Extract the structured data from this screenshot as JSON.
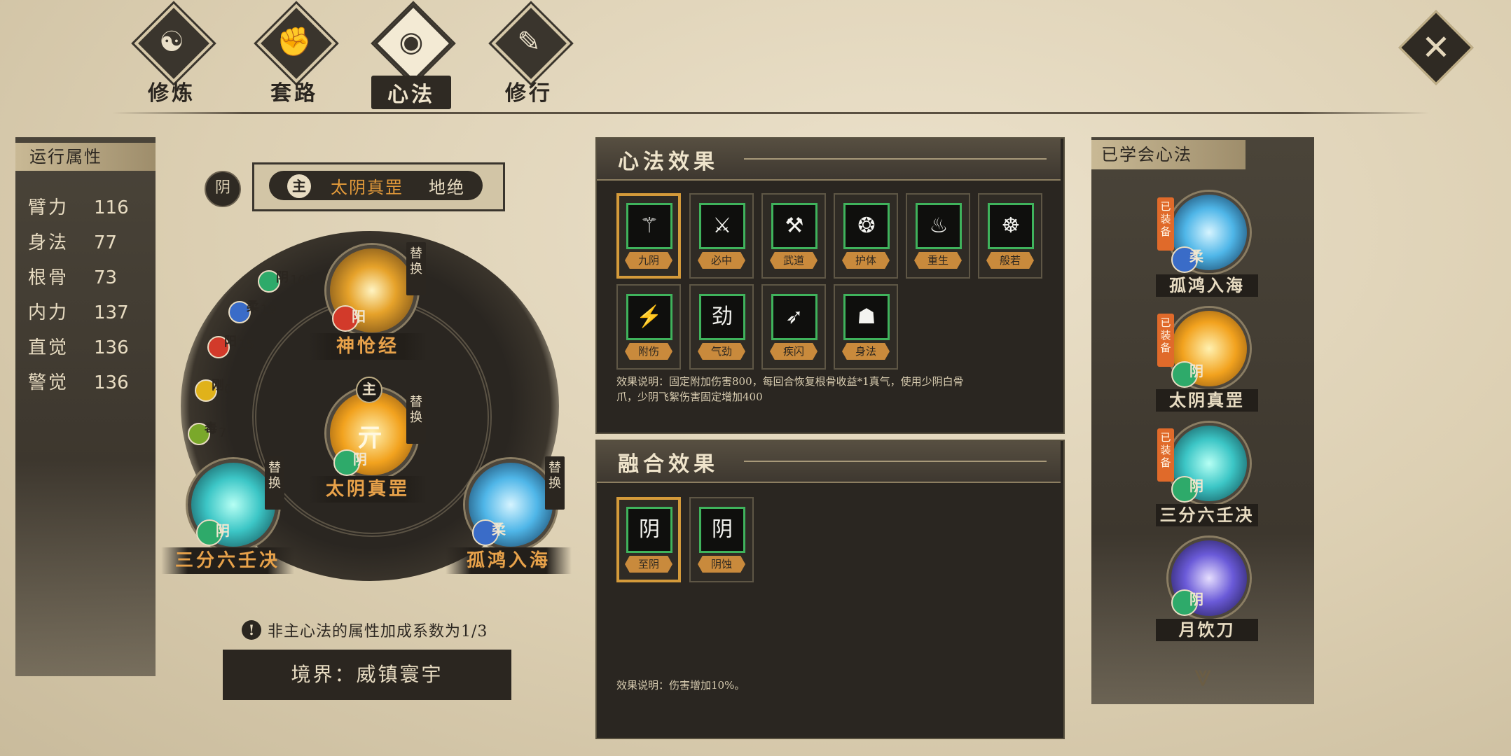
{
  "tabs": [
    {
      "label": "修炼",
      "glyph": "☯",
      "active": false
    },
    {
      "label": "套路",
      "glyph": "✊",
      "active": false
    },
    {
      "label": "心法",
      "glyph": "◉",
      "active": true
    },
    {
      "label": "修行",
      "glyph": "✎",
      "active": false
    }
  ],
  "close_glyph": "✕",
  "stats": {
    "title": "运行属性",
    "rows": [
      {
        "name": "臂力",
        "value": "116"
      },
      {
        "name": "身法",
        "value": "77"
      },
      {
        "name": "根骨",
        "value": "73"
      },
      {
        "name": "内力",
        "value": "137"
      },
      {
        "name": "直觉",
        "value": "136"
      },
      {
        "name": "警觉",
        "value": "136"
      }
    ]
  },
  "main_method": {
    "yin_badge": "阴",
    "zhu_label": "主",
    "name": "太阴真罡",
    "tier": "地绝"
  },
  "wheel": {
    "attributes": [
      {
        "label": "阴",
        "value": "109",
        "color": "#2eaa6a"
      },
      {
        "label": "柔",
        "value": "19",
        "color": "#3a6cc8"
      },
      {
        "label": "阳",
        "value": "15",
        "color": "#d23a2a"
      },
      {
        "label": "刚",
        "value": "0",
        "color": "#e0b21a"
      },
      {
        "label": "毒",
        "value": "7",
        "color": "#7aa82a"
      }
    ],
    "slots": [
      {
        "name": "神怆经",
        "type": "阳",
        "type_color": "#d23a2a",
        "swap": "替换",
        "orb": "#e6a22a"
      },
      {
        "name": "太阴真罡",
        "type": "阴",
        "type_color": "#2eaa6a",
        "swap": "替换",
        "orb": "#f2a21e",
        "zhu": "主",
        "glyph": "亓"
      },
      {
        "name": "三分六壬决",
        "type": "阴",
        "type_color": "#2eaa6a",
        "swap": "替换",
        "orb": "#3cc6c6"
      },
      {
        "name": "孤鸿入海",
        "type": "柔",
        "type_color": "#3a6cc8",
        "swap": "替换",
        "orb": "#4fb6e8"
      }
    ]
  },
  "notice": {
    "icon": "!",
    "text": "非主心法的属性加成系数为1/3"
  },
  "realm": {
    "text": "境界：威镇寰宇"
  },
  "effects": {
    "title": "心法效果",
    "skills": [
      {
        "tag": "九阴",
        "icon": "⚚",
        "selected": true
      },
      {
        "tag": "必中",
        "icon": "⚔",
        "selected": false
      },
      {
        "tag": "武道",
        "icon": "⚒",
        "selected": false
      },
      {
        "tag": "护体",
        "icon": "❂",
        "selected": false
      },
      {
        "tag": "重生",
        "icon": "♨",
        "selected": false
      },
      {
        "tag": "般若",
        "icon": "☸",
        "selected": false
      },
      {
        "tag": "附伤",
        "icon": "⚡",
        "selected": false
      },
      {
        "tag": "气劲",
        "icon": "劲",
        "selected": false
      },
      {
        "tag": "疾闪",
        "icon": "➶",
        "selected": false
      },
      {
        "tag": "身法",
        "icon": "☗",
        "selected": false
      }
    ],
    "desc_line1": "效果说明：固定附加伤害800，每回合恢复根骨收益*1真气，使用少阴白骨",
    "desc_line2": "爪，少阴飞絮伤害固定增加400"
  },
  "fusion": {
    "title": "融合效果",
    "skills": [
      {
        "tag": "至阴",
        "icon": "阴",
        "selected": true
      },
      {
        "tag": "阴蚀",
        "icon": "阴",
        "selected": false
      }
    ],
    "desc": "效果说明：伤害增加10%。"
  },
  "learned": {
    "title": "已学会心法",
    "equip_label": "已装备",
    "items": [
      {
        "name": "孤鸿入海",
        "type": "柔",
        "type_color": "#3a6cc8",
        "orb": "#4fb6e8",
        "equipped": true
      },
      {
        "name": "太阴真罡",
        "type": "阴",
        "type_color": "#2eaa6a",
        "orb": "#f2a21e",
        "equipped": true
      },
      {
        "name": "三分六壬决",
        "type": "阴",
        "type_color": "#2eaa6a",
        "orb": "#3cc6c6",
        "equipped": true
      },
      {
        "name": "月饮刀",
        "type": "阴",
        "type_color": "#2eaa6a",
        "orb": "#6a5ad8",
        "equipped": false
      }
    ],
    "scroll_icon": "⩔"
  }
}
